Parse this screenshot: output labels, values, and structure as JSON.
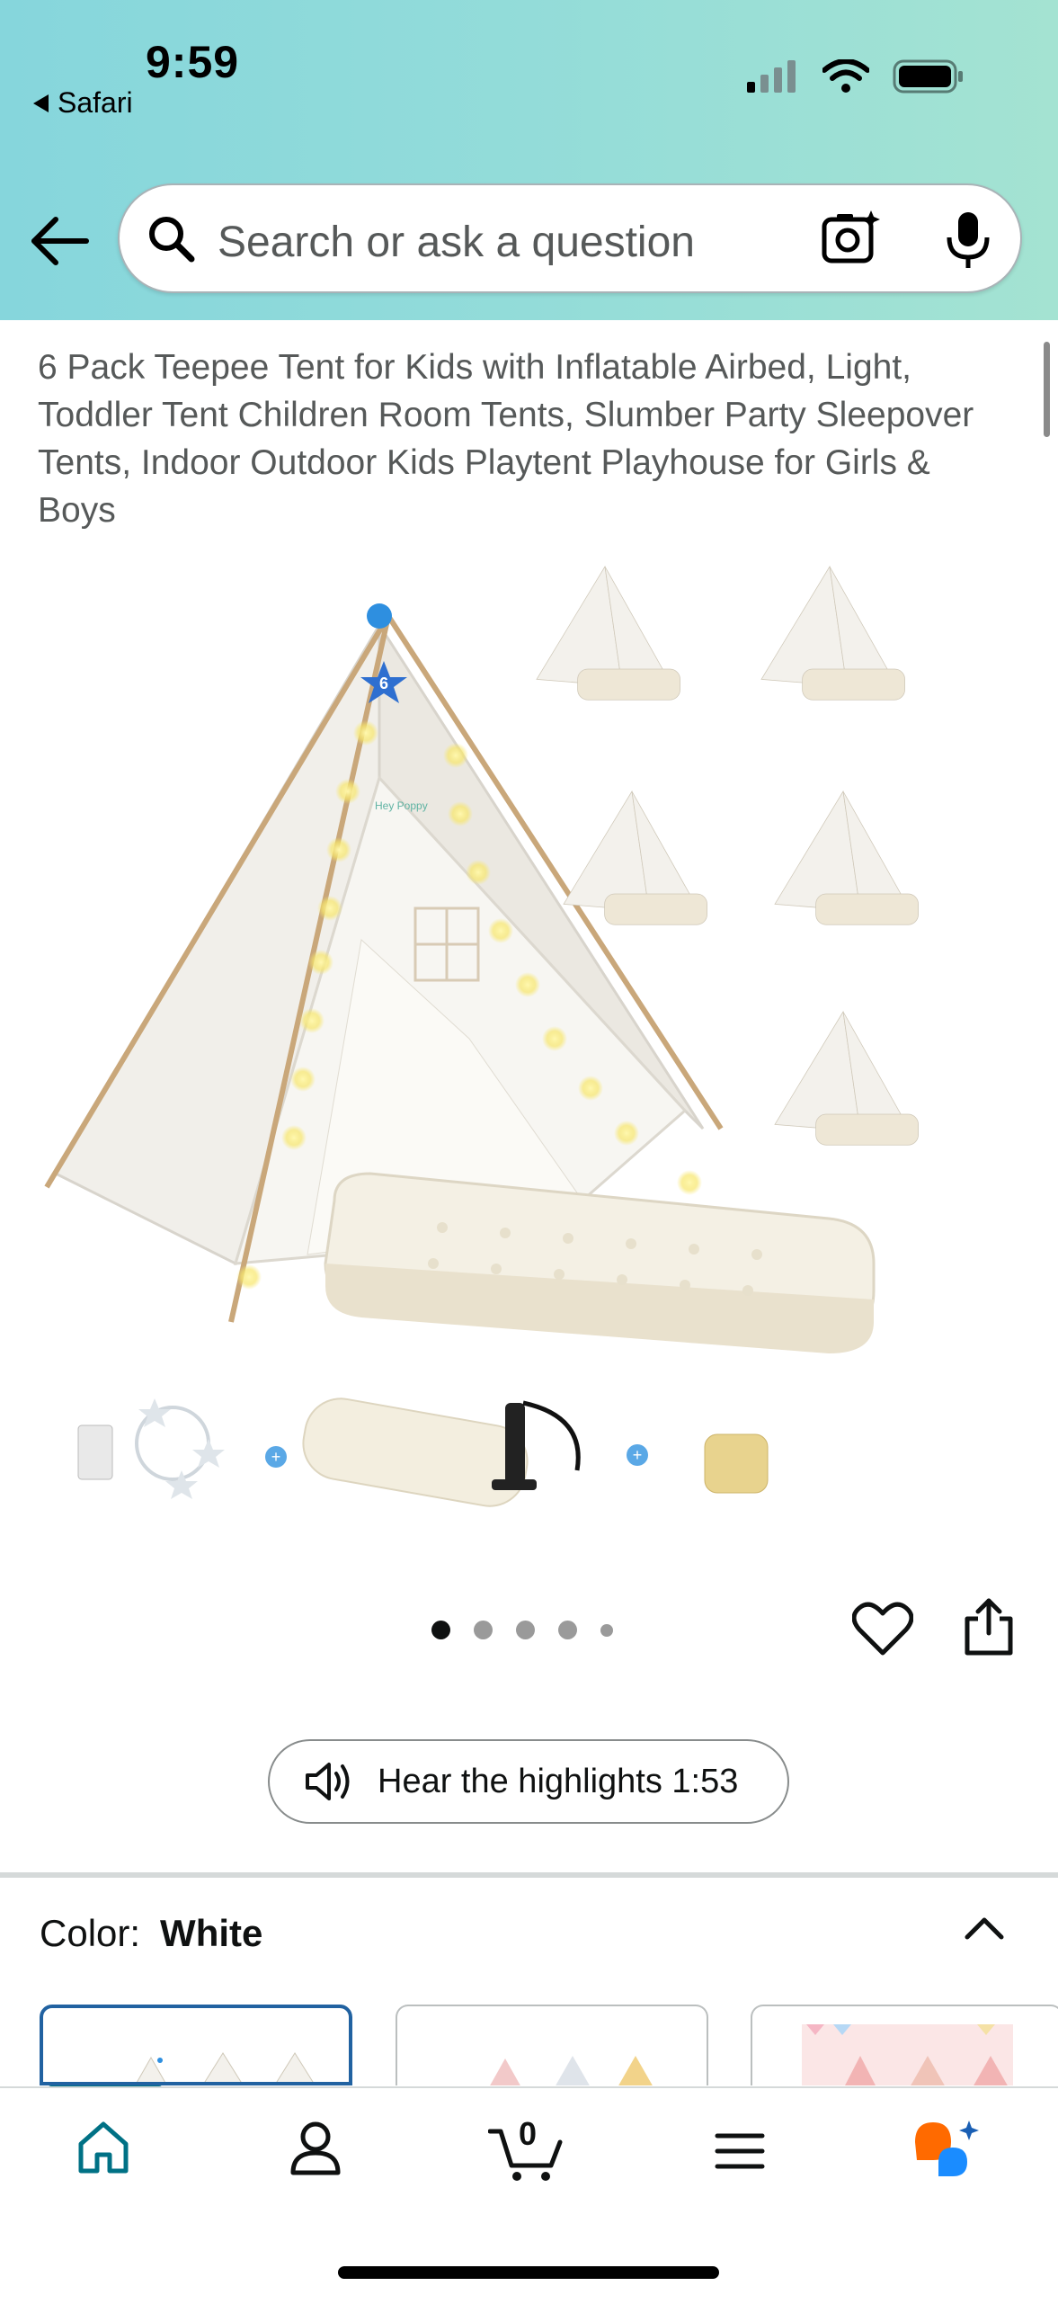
{
  "status_bar": {
    "time": "9:59",
    "back_app": "Safari"
  },
  "search": {
    "placeholder": "Search or ask a question"
  },
  "product": {
    "title": "6 Pack Teepee Tent for Kids with Inflatable Airbed, Light, Toddler Tent Children Room Tents, Slumber Party Sleepover Tents, Indoor Outdoor Kids Playtent Playhouse for Girls & Boys",
    "image_badge": "6",
    "brand_mark": "Hey Poppy",
    "image_count": 5,
    "active_image_index": 0
  },
  "audio": {
    "label": "Hear the highlights 1:53"
  },
  "color": {
    "label": "Color:",
    "value": "White"
  },
  "bottom_nav": {
    "items": [
      "home-icon",
      "account-icon",
      "cart-icon",
      "menu-icon",
      "rufus-icon"
    ],
    "cart_count": "0"
  },
  "colors": {
    "accent_teal": "#007185",
    "selected_border": "#2162a1",
    "rufus_orange": "#ff6a00",
    "rufus_blue": "#1a8cff"
  }
}
